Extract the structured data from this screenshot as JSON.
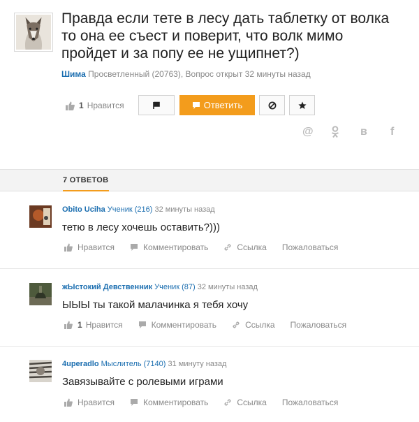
{
  "question": {
    "title": "Правда если тете в лесу дать таблетку от волка то она ее съест и поверит, что волк мимо пройдет и за попу ее не ущипнет?)",
    "author": "Шима",
    "meta_rest": "Просветленный (20763), Вопрос открыт 32 минуты назад",
    "like_count": "1",
    "like_label": "Нравится",
    "answer_button": "Ответить",
    "share": [
      "@",
      "ok",
      "в",
      "f"
    ]
  },
  "answers_header": {
    "count_label": "7 ОТВЕТОВ"
  },
  "answers": [
    {
      "name": "Obito Uciha",
      "rank": "Ученик (216)",
      "time": "32 минуты назад",
      "text": "тетю в лесу хочешь оставить?)))",
      "like_count": "",
      "like_label": "Нравится",
      "comment_label": "Комментировать",
      "link_label": "Ссылка",
      "report_label": "Пожаловаться"
    },
    {
      "name": "жЫстокий Девственник",
      "rank": "Ученик (87)",
      "time": "32 минуты назад",
      "text": "ЫЫЫ ты такой малачинка я тебя хочу",
      "like_count": "1",
      "like_label": "Нравится",
      "comment_label": "Комментировать",
      "link_label": "Ссылка",
      "report_label": "Пожаловаться"
    },
    {
      "name": "4uperadlo",
      "rank": "Мыслитель (7140)",
      "time": "31 минуту назад",
      "text": "Завязывайте с ролевыми играми",
      "like_count": "",
      "like_label": "Нравится",
      "comment_label": "Комментировать",
      "link_label": "Ссылка",
      "report_label": "Пожаловаться"
    }
  ]
}
